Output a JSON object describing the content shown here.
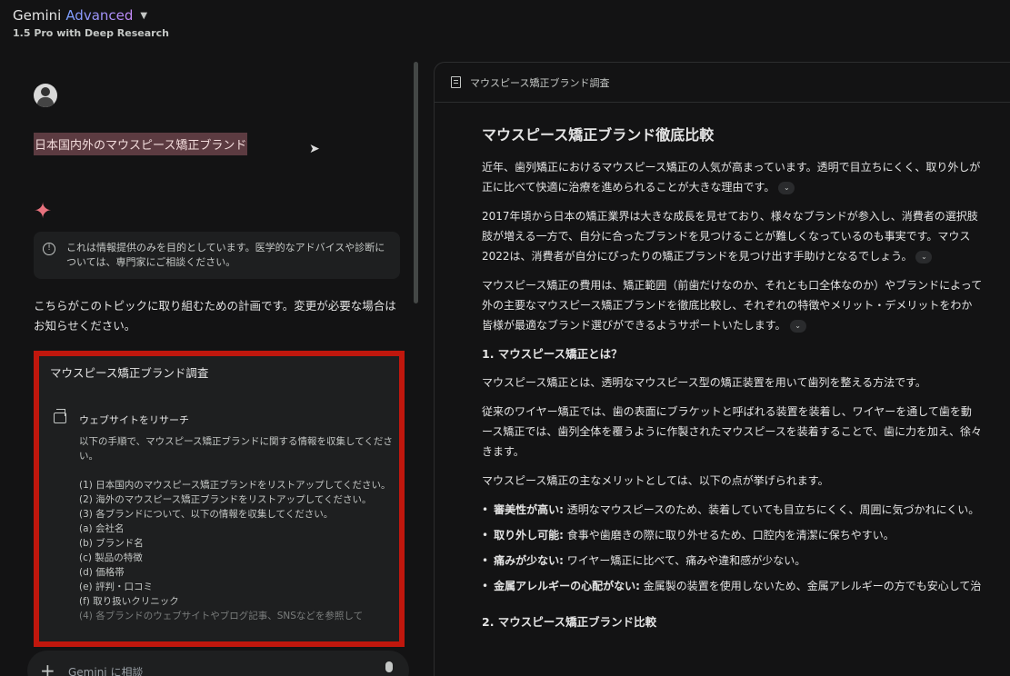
{
  "app": {
    "brand_main": "Gemini",
    "brand_accent": "Advanced",
    "model": "1.5 Pro with Deep Research"
  },
  "chat": {
    "user_query": "日本国内外のマウスピース矯正ブランド",
    "notice": "これは情報提供のみを目的としています。医学的なアドバイスや診断については、専門家にご相談ください。",
    "plan_intro": "こちらがこのトピックに取り組むための計画です。変更が必要な場合はお知らせください。",
    "plan": {
      "title": "マウスピース矯正ブランド調査",
      "step_label": "ウェブサイトをリサーチ",
      "step_intro": "以下の手順で、マウスピース矯正ブランドに関する情報を収集してください。",
      "items": [
        "(1) 日本国内のマウスピース矯正ブランドをリストアップしてください。",
        "(2) 海外のマウスピース矯正ブランドをリストアップしてください。",
        "(3) 各ブランドについて、以下の情報を収集してください。",
        "(a) 会社名",
        "(b) ブランド名",
        "(c) 製品の特徴",
        "(d) 価格帯",
        "(e) 評判・口コミ",
        "(f) 取り扱いクリニック"
      ],
      "faded_item": "(4) 各ブランドのウェブサイトやブログ記事、SNSなどを参照して"
    },
    "input_placeholder": "Gemini に相談"
  },
  "document": {
    "header_title": "マウスピース矯正ブランド調査",
    "title": "マウスピース矯正ブランド徹底比較",
    "paragraphs": [
      [
        "近年、歯列矯正におけるマウスピース矯正の人気が高まっています。透明で目立ちにくく、取り外しが",
        "正に比べて快適に治療を進められることが大きな理由です。"
      ],
      [
        "2017年頃から日本の矯正業界は大きな成長を見せており、様々なブランドが参入し、消費者の選択肢",
        "肢が増える一方で、自分に合ったブランドを見つけることが難しくなっているのも事実です。マウス",
        "2022は、消費者が自分にぴったりの矯正ブランドを見つけ出す手助けとなるでしょう。"
      ],
      [
        "マウスピース矯正の費用は、矯正範囲（前歯だけなのか、それとも口全体なのか）やブランドによって",
        "外の主要なマウスピース矯正ブランドを徹底比較し、それぞれの特徴やメリット・デメリットをわか",
        "皆様が最適なブランド選びができるようサポートいたします。"
      ]
    ],
    "section1_heading": "1. マウスピース矯正とは？",
    "section1_p1": "マウスピース矯正とは、透明なマウスピース型の矯正装置を用いて歯列を整える方法です。",
    "section1_p2": [
      "従来のワイヤー矯正では、歯の表面にブラケットと呼ばれる装置を装着し、ワイヤーを通して歯を動",
      "ース矯正では、歯列全体を覆うように作製されたマウスピースを装着することで、歯に力を加え、徐々",
      "きます。"
    ],
    "section1_p3": "マウスピース矯正の主なメリットとしては、以下の点が挙げられます。",
    "benefits": [
      {
        "bold": "審美性が高い:",
        "text": " 透明なマウスピースのため、装着していても目立ちにくく、周囲に気づかれにくい。"
      },
      {
        "bold": "取り外し可能:",
        "text": " 食事や歯磨きの際に取り外せるため、口腔内を清潔に保ちやすい。"
      },
      {
        "bold": "痛みが少ない:",
        "text": " ワイヤー矯正に比べて、痛みや違和感が少ない。"
      },
      {
        "bold": "金属アレルギーの心配がない:",
        "text": " 金属製の装置を使用しないため、金属アレルギーの方でも安心して治"
      }
    ],
    "section2_heading": "2. マウスピース矯正ブランド比較"
  }
}
